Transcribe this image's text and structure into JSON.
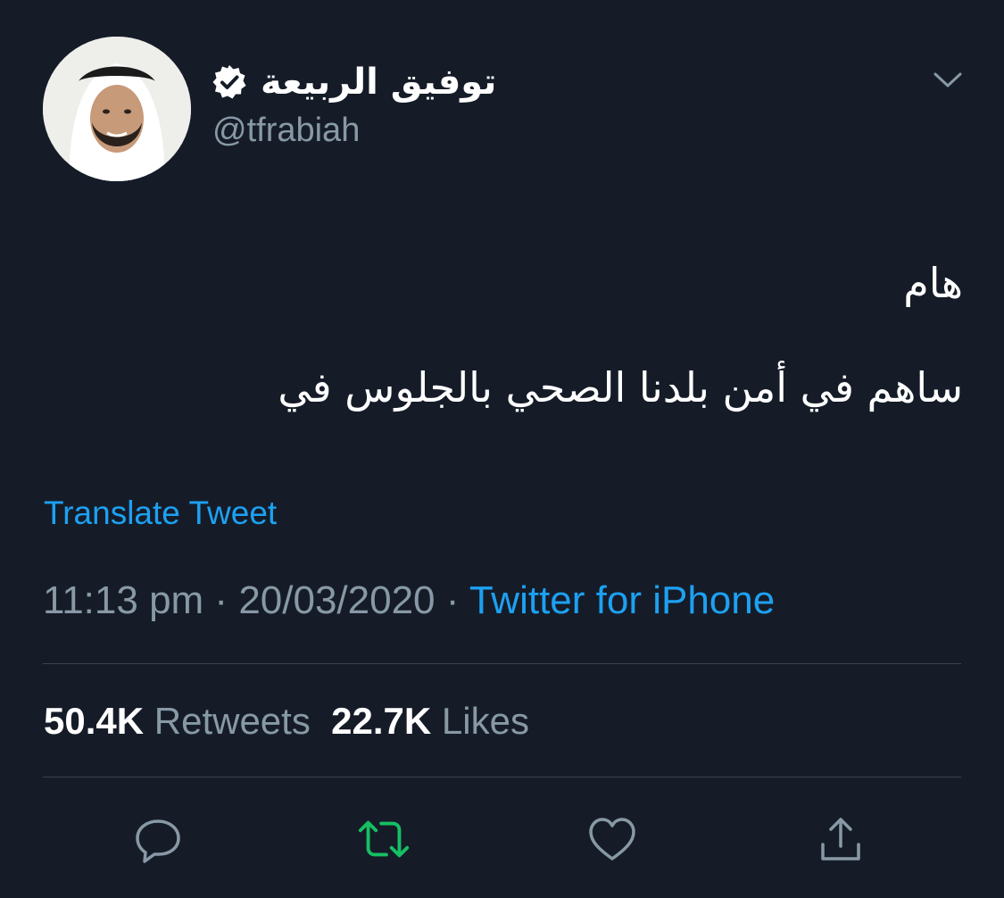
{
  "author": {
    "display_name": "توفيق الربيعة",
    "handle": "@tfrabiah",
    "verified": true
  },
  "tweet": {
    "lines": [
      "هام",
      "ساهم في أمن بلدنا الصحي بالجلوس في"
    ]
  },
  "translate_label": "Translate Tweet",
  "meta": {
    "time": "11:13 pm",
    "separator": " · ",
    "date": "20/03/2020",
    "source": "Twitter for iPhone"
  },
  "stats": {
    "retweets_count": "50.4K",
    "retweets_label": "Retweets",
    "likes_count": "22.7K",
    "likes_label": "Likes"
  },
  "actions": {
    "reply_icon": "reply-icon",
    "retweet_icon": "retweet-icon",
    "like_icon": "heart-icon",
    "share_icon": "share-icon"
  },
  "colors": {
    "background": "#151c28",
    "link": "#1da1f2",
    "muted": "#8899a6",
    "retweet_active": "#17bf63",
    "divider": "#38444d"
  }
}
